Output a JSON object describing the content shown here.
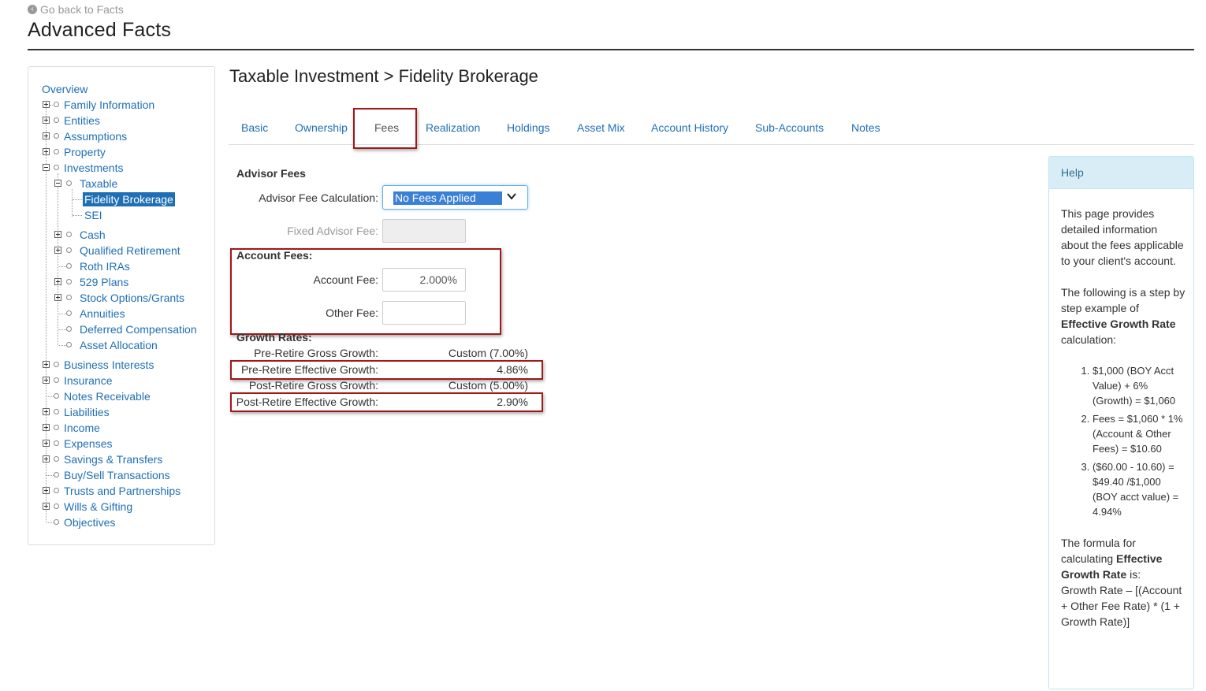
{
  "header": {
    "back_link": "Go back to Facts",
    "title": "Advanced Facts"
  },
  "sidebar": {
    "overview": "Overview",
    "items": [
      "Family Information",
      "Entities",
      "Assumptions",
      "Property",
      "Investments",
      "Taxable",
      "Fidelity Brokerage",
      "SEI",
      "Cash",
      "Qualified Retirement",
      "Roth IRAs",
      "529 Plans",
      "Stock Options/Grants",
      "Annuities",
      "Deferred Compensation",
      "Asset Allocation",
      "Business Interests",
      "Insurance",
      "Notes Receivable",
      "Liabilities",
      "Income",
      "Expenses",
      "Savings & Transfers",
      "Buy/Sell Transactions",
      "Trusts and Partnerships",
      "Wills & Gifting",
      "Objectives"
    ]
  },
  "main": {
    "title": "Taxable Investment > Fidelity Brokerage",
    "tabs": [
      "Basic",
      "Ownership",
      "Fees",
      "Realization",
      "Holdings",
      "Asset Mix",
      "Account History",
      "Sub-Accounts",
      "Notes"
    ],
    "active_tab": "Fees",
    "advisor_fees": {
      "heading": "Advisor Fees",
      "calc_label": "Advisor Fee Calculation:",
      "calc_value": "No Fees Applied",
      "fixed_label": "Fixed Advisor Fee:",
      "fixed_value": ""
    },
    "account_fees": {
      "heading": "Account Fees:",
      "account_fee_label": "Account Fee:",
      "account_fee_value": "2.000%",
      "other_fee_label": "Other Fee:",
      "other_fee_value": ""
    },
    "growth": {
      "heading": "Growth Rates:",
      "rows": [
        {
          "label": "Pre-Retire Gross Growth:",
          "value": "Custom (7.00%)"
        },
        {
          "label": "Pre-Retire Effective Growth:",
          "value": "4.86%"
        },
        {
          "label": "Post-Retire Gross Growth:",
          "value": "Custom (5.00%)"
        },
        {
          "label": "Post-Retire Effective Growth:",
          "value": "2.90%"
        }
      ]
    }
  },
  "help": {
    "title": "Help",
    "p1": "This page provides detailed information about the fees applicable to your client's account.",
    "p2_a": "The following is a step by step example of ",
    "p2_b": "Effective Growth Rate",
    "p2_c": " calculation:",
    "steps": [
      "$1,000 (BOY Acct Value) + 6% (Growth) = $1,060",
      "Fees = $1,060 * 1% (Account & Other Fees) = $10.60",
      "($60.00 - 10.60) = $49.40 /$1,000 (BOY acct value) = 4.94%"
    ],
    "p3_a": "The formula for calculating ",
    "p3_b": "Effective Growth Rate",
    "p3_c": " is:",
    "p3_d": "Growth Rate – [(Account + Other Fee Rate) * (1 + Growth Rate)]"
  },
  "colors": {
    "link": "#1f6fb5",
    "highlight_box": "#a01818",
    "help_header": "#d9edf7",
    "selected_item": "#1f6fb5"
  }
}
